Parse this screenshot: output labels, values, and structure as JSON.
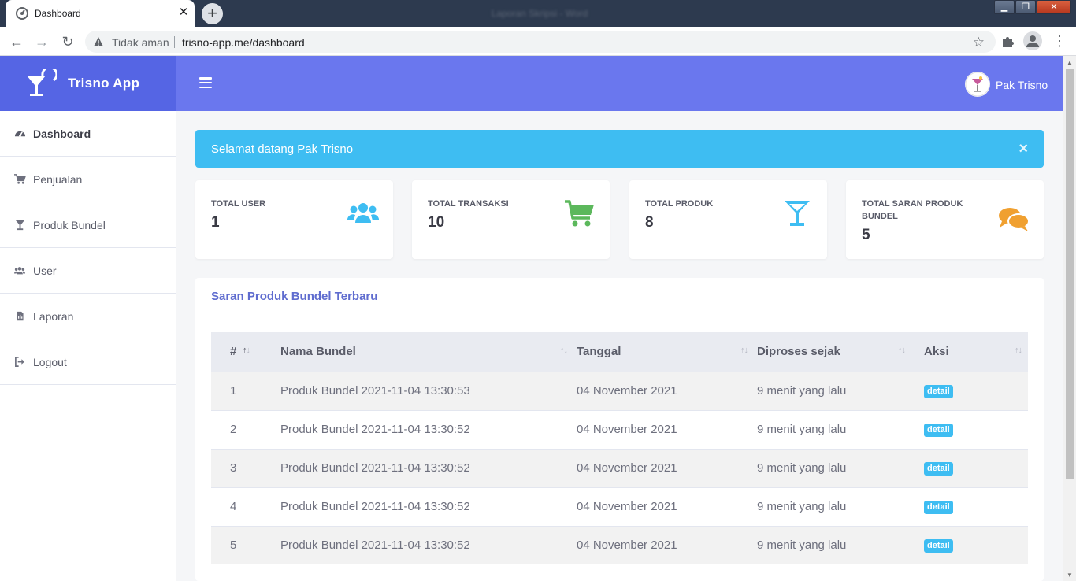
{
  "browser": {
    "tab_title": "Dashboard",
    "window_title": "Laporan Skripsi - Word",
    "security_text": "Tidak aman",
    "url": "trisno-app.me/dashboard"
  },
  "app": {
    "brand_name": "Trisno App",
    "user_name": "Pak Trisno"
  },
  "sidebar": {
    "items": [
      {
        "label": "Dashboard",
        "icon": "tachometer-icon",
        "active": true
      },
      {
        "label": "Penjualan",
        "icon": "cart-icon",
        "active": false
      },
      {
        "label": "Produk Bundel",
        "icon": "cocktail-glass-icon",
        "active": false
      },
      {
        "label": "User",
        "icon": "users-icon",
        "active": false
      },
      {
        "label": "Laporan",
        "icon": "report-file-icon",
        "active": false
      },
      {
        "label": "Logout",
        "icon": "logout-icon",
        "active": false
      }
    ]
  },
  "alert": {
    "message": "Selamat datang Pak Trisno",
    "close_label": "×"
  },
  "stats": [
    {
      "label": "TOTAL USER",
      "value": "1",
      "icon": "users-icon",
      "color": "#3ebdf2"
    },
    {
      "label": "TOTAL TRANSAKSI",
      "value": "10",
      "icon": "cart-icon",
      "color": "#5cb85c"
    },
    {
      "label": "TOTAL PRODUK",
      "value": "8",
      "icon": "cocktail-glass-icon",
      "color": "#3ebdf2"
    },
    {
      "label": "TOTAL SARAN PRODUK BUNDEL",
      "value": "5",
      "icon": "comments-icon",
      "color": "#f0a030"
    }
  ],
  "panel": {
    "title": "Saran Produk Bundel Terbaru"
  },
  "table": {
    "columns": [
      "#",
      "Nama Bundel",
      "Tanggal",
      "Diproses sejak",
      "Aksi"
    ],
    "rows": [
      {
        "no": "1",
        "nama": "Produk Bundel 2021-11-04 13:30:53",
        "tanggal": "04 November 2021",
        "sejak": "9 menit yang lalu",
        "aksi": "detail"
      },
      {
        "no": "2",
        "nama": "Produk Bundel 2021-11-04 13:30:52",
        "tanggal": "04 November 2021",
        "sejak": "9 menit yang lalu",
        "aksi": "detail"
      },
      {
        "no": "3",
        "nama": "Produk Bundel 2021-11-04 13:30:52",
        "tanggal": "04 November 2021",
        "sejak": "9 menit yang lalu",
        "aksi": "detail"
      },
      {
        "no": "4",
        "nama": "Produk Bundel 2021-11-04 13:30:52",
        "tanggal": "04 November 2021",
        "sejak": "9 menit yang lalu",
        "aksi": "detail"
      },
      {
        "no": "5",
        "nama": "Produk Bundel 2021-11-04 13:30:52",
        "tanggal": "04 November 2021",
        "sejak": "9 menit yang lalu",
        "aksi": "detail"
      }
    ]
  },
  "colors": {
    "brand": "#5565e4",
    "topbar": "#6a77ee",
    "info": "#3ebdf2",
    "success": "#5cb85c",
    "warning": "#f0a030"
  }
}
